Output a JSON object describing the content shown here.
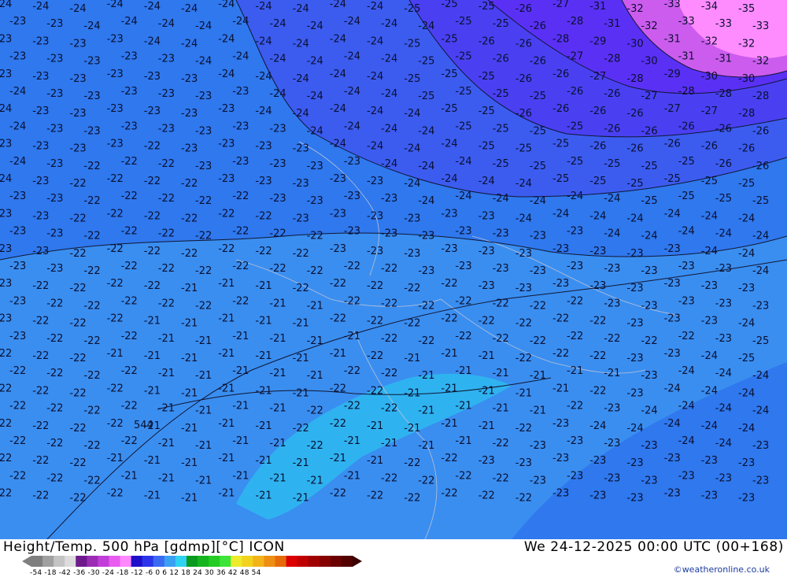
{
  "map": {
    "city_label": "544",
    "colors": {
      "band_m21": "#2fb3f0",
      "band_m22": "#3a8ef0",
      "band_m23": "#2f78ee",
      "band_m24": "#3c5cf0",
      "band_m25": "#4a40f2",
      "band_m26_27": "#5a30f5",
      "band_m28_31": "#cc5cee",
      "band_m32_plus": "#ff8cff",
      "borders": "#b8c2d8",
      "contour": "#111633"
    },
    "contour_labels": [
      "-21",
      "-22",
      "-23",
      "-24",
      "-25",
      "-26",
      "-27",
      "-28",
      "-29",
      "-30",
      "-31",
      "-32",
      "-33",
      "-34",
      "-35"
    ]
  },
  "footer": {
    "title_left": "Height/Temp. 500 hPa [gdmp][°C] ICON",
    "title_right": "We 24-12-2025 00:00 UTC (00+168)",
    "scale_labels": "-54 -18 -42 -36 -30 -24 -18 -12 -6 0 6 12 18 24 30 36 42 48 54",
    "scale_colors": [
      "#7f7f7f",
      "#a0a0a0",
      "#c4c4c4",
      "#dcdcdc",
      "#6e1a8c",
      "#9a2cb4",
      "#c23ed8",
      "#e85cf0",
      "#ff88ff",
      "#1e10c8",
      "#2c34ea",
      "#3a6af2",
      "#3aa0f2",
      "#2fd2f0",
      "#0a9a1e",
      "#16b41e",
      "#24cc24",
      "#3ee43a",
      "#ecec2a",
      "#f2d21e",
      "#f2b41a",
      "#ee8e12",
      "#e66a0a",
      "#dc0000",
      "#c00000",
      "#a00000",
      "#860000",
      "#6a0000",
      "#520000"
    ],
    "credit": "©weatheronline.co.uk"
  }
}
